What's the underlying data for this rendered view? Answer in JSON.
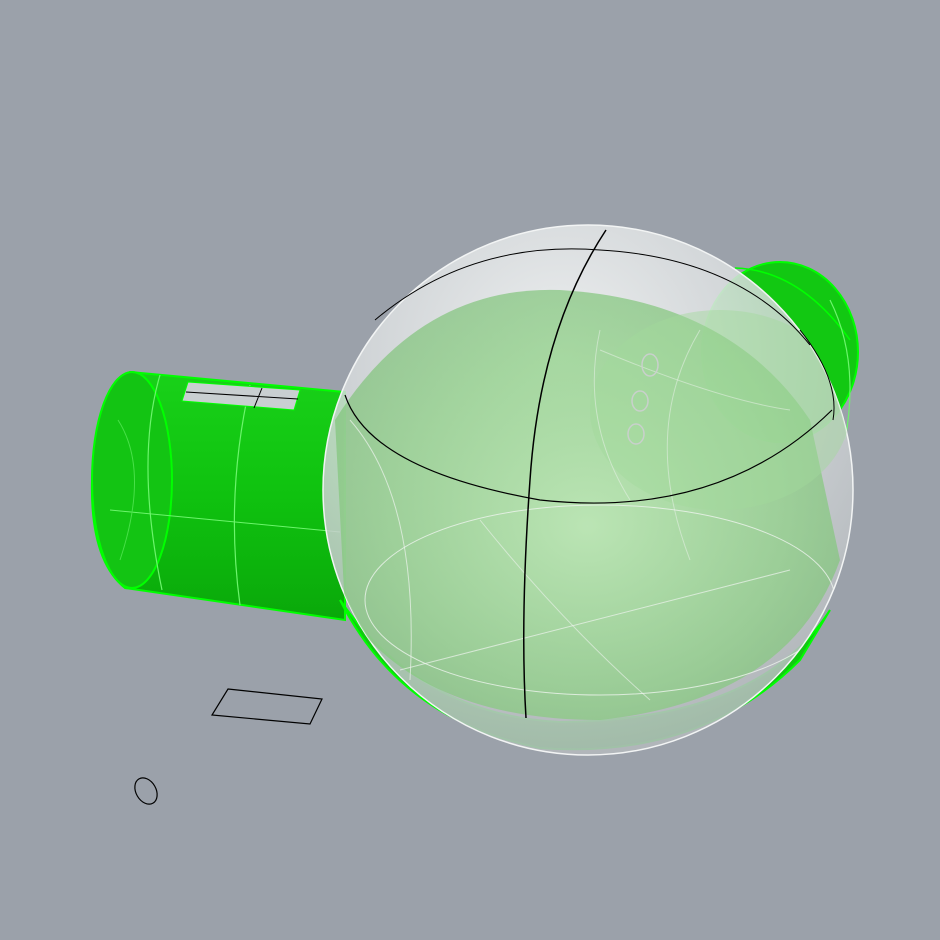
{
  "viewport": {
    "background": "#9ba1aa",
    "selection_color": "#00ff00",
    "selected_fill": "#12c812",
    "ghost_fill": "#e4e6ea",
    "curve_color": "#000000"
  },
  "objects": [
    {
      "name": "cylinder",
      "state": "selected"
    },
    {
      "name": "back-cap-sphere",
      "state": "selected"
    },
    {
      "name": "main-sphere",
      "state": "ghosted"
    },
    {
      "name": "rectangle-curve",
      "state": "unselected"
    },
    {
      "name": "ellipse-curve",
      "state": "unselected"
    }
  ]
}
